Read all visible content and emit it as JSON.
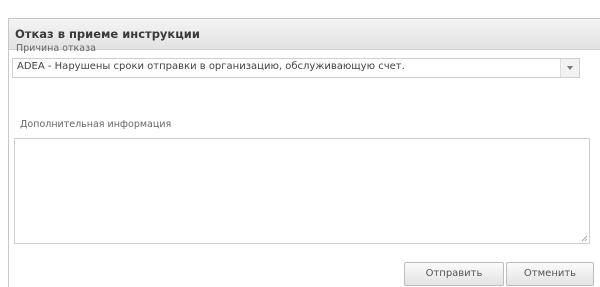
{
  "dialog": {
    "title": "Отказ в приеме инструкции",
    "close_icon": "close-icon"
  },
  "reason": {
    "label": "Причина отказа",
    "value": "ADEA - Нарушены сроки отправки в организацию, обслуживающую счет.",
    "dropdown_icon": "chevron-down-icon"
  },
  "info": {
    "label": "Дополнительная информация",
    "value": ""
  },
  "buttons": {
    "send_label": "Отправить",
    "cancel_label": "Отменить"
  }
}
